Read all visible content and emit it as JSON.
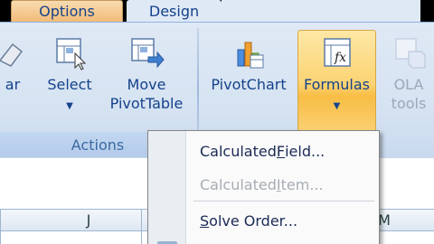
{
  "tabs": {
    "options": "Options",
    "design": "Design"
  },
  "ribbon": {
    "partial_left_label": "ar",
    "select": {
      "label": "Select"
    },
    "move_pivottable": {
      "line1": "Move",
      "line2": "PivotTable"
    },
    "pivotchart": {
      "label": "PivotChart"
    },
    "formulas": {
      "label": "Formulas"
    },
    "olap_tools": {
      "line1": "OLA",
      "line2": "tools"
    },
    "groups": {
      "actions": "Actions"
    }
  },
  "sheet": {
    "col_j": "J",
    "col_m": "M"
  },
  "menu": {
    "calculated_field": {
      "before": "Calculated ",
      "underlined": "F",
      "after": "ield..."
    },
    "calculated_item": {
      "before": "Calculated ",
      "underlined": "I",
      "after": "tem..."
    },
    "solve_order": {
      "underlined": "S",
      "after": "olve Order..."
    }
  }
}
